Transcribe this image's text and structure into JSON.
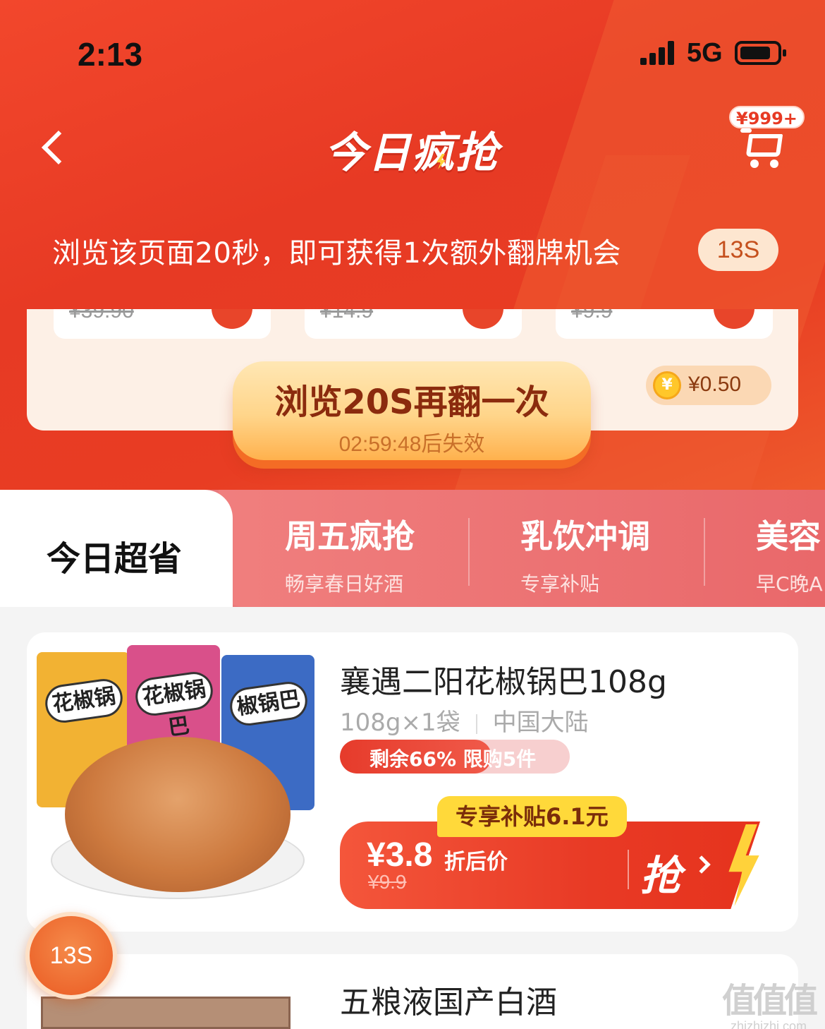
{
  "status_bar": {
    "time": "2:13",
    "network": "5G"
  },
  "header": {
    "title": "今日疯抢",
    "cart_badge": "¥999+"
  },
  "notice": {
    "text": "浏览该页面20秒，即可获得1次额外翻牌机会",
    "countdown": "13S"
  },
  "mini_cards": [
    {
      "old_price": "¥39.90"
    },
    {
      "old_price": "¥14.9"
    },
    {
      "old_price": "¥9.9"
    }
  ],
  "flip": {
    "main": "浏览20S再翻一次",
    "sub": "02:59:48后失效",
    "coin_amount": "¥0.50"
  },
  "tabs": {
    "active": "今日超省",
    "items": [
      {
        "title": "周五疯抢",
        "sub": "畅享春日好酒"
      },
      {
        "title": "乳饮冲调",
        "sub": "专享补贴"
      },
      {
        "title": "美容",
        "sub": "早C晚A"
      }
    ]
  },
  "product1": {
    "name": "襄遇二阳花椒锅巴108g",
    "spec": "108g×1袋",
    "origin": "中国大陆",
    "stock_text": "剩余66% 限购5件",
    "stock_fraction": 0.66,
    "subsidy": "专享补贴6.1元",
    "price_now": "¥3.8",
    "price_label": "折后价",
    "price_old": "¥9.9",
    "buy_label": "抢",
    "bag_labels": [
      "花椒锅",
      "花椒锅巴",
      "椒锅巴"
    ]
  },
  "product2": {
    "name": "五粮液国产白酒"
  },
  "float_timer": "13S",
  "watermark": {
    "main": "值值值",
    "sub": "zhizhizhi.com"
  },
  "colors": {
    "brand_red": "#e73a24",
    "accent_yellow": "#ffd93a"
  }
}
